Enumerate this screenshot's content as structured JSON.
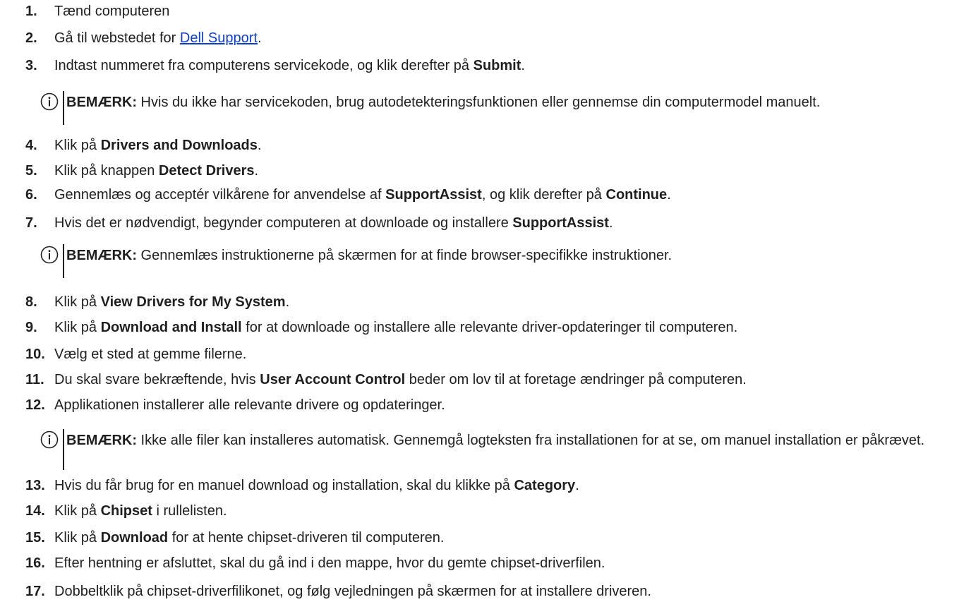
{
  "steps": [
    {
      "num": "1.",
      "parts": [
        {
          "t": "Tænd computeren"
        }
      ]
    },
    {
      "num": "2.",
      "parts": [
        {
          "t": "Gå til webstedet for "
        },
        {
          "t": "Dell Support",
          "link": true
        },
        {
          "t": "."
        }
      ]
    },
    {
      "num": "3.",
      "parts": [
        {
          "t": "Indtast nummeret fra computerens servicekode, og klik derefter på "
        },
        {
          "t": "Submit",
          "b": true
        },
        {
          "t": "."
        }
      ]
    },
    {
      "num": "4.",
      "parts": [
        {
          "t": "Klik på "
        },
        {
          "t": "Drivers and Downloads",
          "b": true
        },
        {
          "t": "."
        }
      ]
    },
    {
      "num": "5.",
      "parts": [
        {
          "t": "Klik på knappen "
        },
        {
          "t": "Detect Drivers",
          "b": true
        },
        {
          "t": "."
        }
      ]
    },
    {
      "num": "6.",
      "parts": [
        {
          "t": "Gennemlæs og acceptér vilkårene for anvendelse af "
        },
        {
          "t": "SupportAssist",
          "b": true
        },
        {
          "t": ", og klik derefter på "
        },
        {
          "t": "Continue",
          "b": true
        },
        {
          "t": "."
        }
      ]
    },
    {
      "num": "7.",
      "parts": [
        {
          "t": "Hvis det er nødvendigt, begynder computeren at downloade og installere "
        },
        {
          "t": "SupportAssist",
          "b": true
        },
        {
          "t": "."
        }
      ]
    },
    {
      "num": "8.",
      "parts": [
        {
          "t": "Klik på "
        },
        {
          "t": "View Drivers for My System",
          "b": true
        },
        {
          "t": "."
        }
      ]
    },
    {
      "num": "9.",
      "parts": [
        {
          "t": "Klik på "
        },
        {
          "t": "Download and Install",
          "b": true
        },
        {
          "t": " for at downloade og installere alle relevante driver-opdateringer til computeren."
        }
      ]
    },
    {
      "num": "10.",
      "parts": [
        {
          "t": "Vælg et sted at gemme filerne."
        }
      ]
    },
    {
      "num": "11.",
      "parts": [
        {
          "t": "Du skal svare bekræftende, hvis "
        },
        {
          "t": "User Account Control",
          "b": true
        },
        {
          "t": " beder om lov til at foretage ændringer på computeren."
        }
      ]
    },
    {
      "num": "12.",
      "parts": [
        {
          "t": "Applikationen installerer alle relevante drivere og opdateringer."
        }
      ]
    },
    {
      "num": "13.",
      "parts": [
        {
          "t": "Hvis du får brug for en manuel download og installation, skal du klikke på "
        },
        {
          "t": "Category",
          "b": true
        },
        {
          "t": "."
        }
      ]
    },
    {
      "num": "14.",
      "parts": [
        {
          "t": "Klik på "
        },
        {
          "t": "Chipset",
          "b": true
        },
        {
          "t": " i rullelisten."
        }
      ]
    },
    {
      "num": "15.",
      "parts": [
        {
          "t": "Klik på "
        },
        {
          "t": "Download",
          "b": true
        },
        {
          "t": " for at hente chipset-driveren til computeren."
        }
      ]
    },
    {
      "num": "16.",
      "parts": [
        {
          "t": "Efter hentning er afsluttet, skal du gå ind i den mappe, hvor du gemte chipset-driverfilen."
        }
      ]
    },
    {
      "num": "17.",
      "parts": [
        {
          "t": "Dobbeltklik på chipset-driverfilikonet, og følg vejledningen på skærmen for at installere driveren."
        }
      ]
    }
  ],
  "notes": [
    {
      "label": "BEMÆRK:",
      "text": " Hvis du ikke har servicekoden, brug autodetekteringsfunktionen eller gennemse din computermodel manuelt."
    },
    {
      "label": "BEMÆRK:",
      "text": " Gennemlæs instruktionerne på skærmen for at finde browser-specifikke instruktioner."
    },
    {
      "label": "BEMÆRK:",
      "text": " Ikke alle filer kan installeres automatisk. Gennemgå logteksten fra installationen for at se, om manuel installation er påkrævet."
    }
  ],
  "colors": {
    "text": "#1f1f1f",
    "link": "#0b3fd6"
  },
  "icons": {
    "note": "info-icon"
  }
}
